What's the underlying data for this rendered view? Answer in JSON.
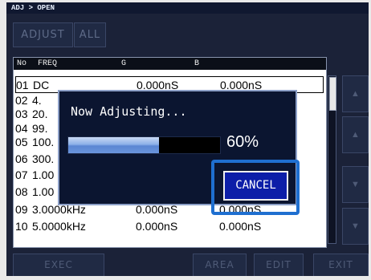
{
  "breadcrumb": "ADJ > OPEN",
  "top_buttons": {
    "adjust": "ADJUST",
    "all": "ALL"
  },
  "table": {
    "headers": {
      "no": "No",
      "freq": "FREQ",
      "g": "G",
      "b": "B"
    },
    "rows": [
      {
        "no": "01",
        "freq": "DC",
        "g": "0.000nS",
        "b": "0.000nS"
      },
      {
        "no": "02",
        "freq": "4.",
        "g": "",
        "b": ""
      },
      {
        "no": "03",
        "freq": "20.",
        "g": "",
        "b": ""
      },
      {
        "no": "04",
        "freq": "99.",
        "g": "",
        "b": ""
      },
      {
        "no": "05",
        "freq": "100.",
        "g": "",
        "b": ""
      },
      {
        "no": "06",
        "freq": "300.",
        "g": "",
        "b": ""
      },
      {
        "no": "07",
        "freq": "1.00",
        "g": "",
        "b": ""
      },
      {
        "no": "08",
        "freq": "1.00",
        "g": "",
        "b": ""
      },
      {
        "no": "09",
        "freq": "3.0000kHz",
        "g": "0.000nS",
        "b": "0.000nS"
      },
      {
        "no": "10",
        "freq": "5.0000kHz",
        "g": "0.000nS",
        "b": "0.000nS"
      }
    ]
  },
  "dialog": {
    "title": "Now Adjusting...",
    "progress_percent": 60,
    "progress_text": "60%",
    "cancel_label": "CANCEL"
  },
  "bottom_buttons": {
    "exec": "EXEC",
    "area": "AREA",
    "edit": "EDIT",
    "exit": "EXIT"
  },
  "colors": {
    "background": "#1b2238",
    "dialog": "#0b1530",
    "cancel": "#0c1ea8",
    "highlight": "#1f6fd0"
  }
}
